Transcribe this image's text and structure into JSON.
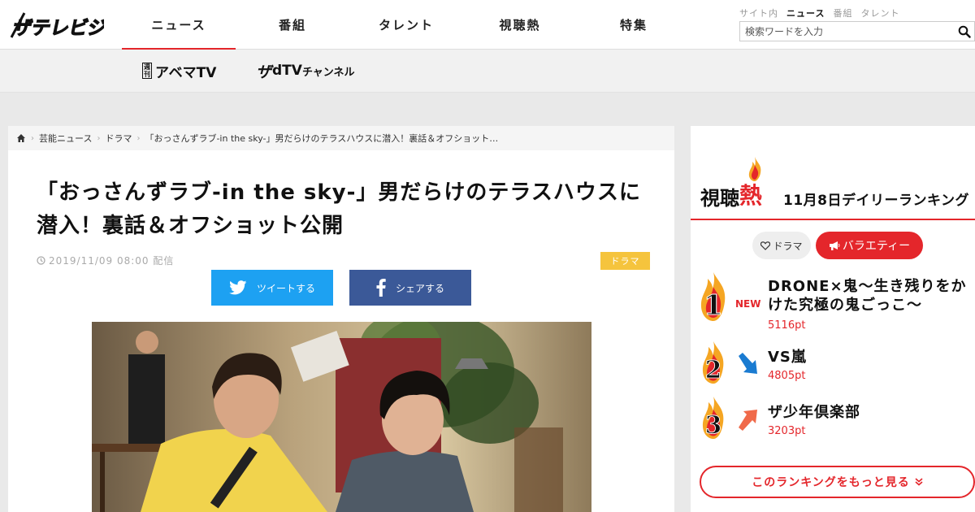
{
  "brand": {
    "logo_text": "ザテレビジョン",
    "accent": "#e4262b"
  },
  "nav": {
    "items": [
      {
        "label": "ニュース",
        "active": true
      },
      {
        "label": "番組",
        "active": false
      },
      {
        "label": "タレント",
        "active": false
      },
      {
        "label": "視聴熱",
        "active": false
      },
      {
        "label": "特集",
        "active": false
      }
    ]
  },
  "search": {
    "tabs": [
      "サイト内",
      "ニュース",
      "番組",
      "タレント"
    ],
    "selected_tab": "ニュース",
    "placeholder": "検索ワードを入力"
  },
  "subnav": {
    "abema_badge": "週刊",
    "abema_label": "アベマTV",
    "dtv_prefix": "ザ",
    "dtv_label": "dTV",
    "dtv_suffix": "チャンネル"
  },
  "breadcrumb": [
    "芸能ニュース",
    "ドラマ",
    "「おっさんずラブ-in the sky-」男だらけのテラスハウスに潜入！裏話＆オフショット…"
  ],
  "article": {
    "title": "「おっさんずラブ-in the sky-」男だらけのテラスハウスに潜入！裏話＆オフショット公開",
    "date": "2019/11/09 08:00 配信",
    "tag": "ドラマ",
    "tweet_label": "ツイートする",
    "share_label": "シェアする",
    "tag_color": "#f5c43d",
    "twitter_color": "#1da1f2",
    "facebook_color": "#3b5998"
  },
  "ranking": {
    "heading_a": "視聴",
    "heading_b": "熱",
    "date_title": "11月8日デイリーランキング",
    "tabs": [
      "ドラマ",
      "バラエティー"
    ],
    "active_tab": "バラエティー",
    "items": [
      {
        "rank": "1",
        "status": "NEW",
        "title": "DRONE×鬼〜生き残りをかけた究極の鬼ごっこ〜",
        "points": "5116pt"
      },
      {
        "rank": "2",
        "trend": "down",
        "title": "VS嵐",
        "points": "4805pt"
      },
      {
        "rank": "3",
        "trend": "up",
        "title": "ザ少年倶楽部",
        "points": "3203pt"
      }
    ],
    "more_label": "このランキングをもっと見る"
  }
}
